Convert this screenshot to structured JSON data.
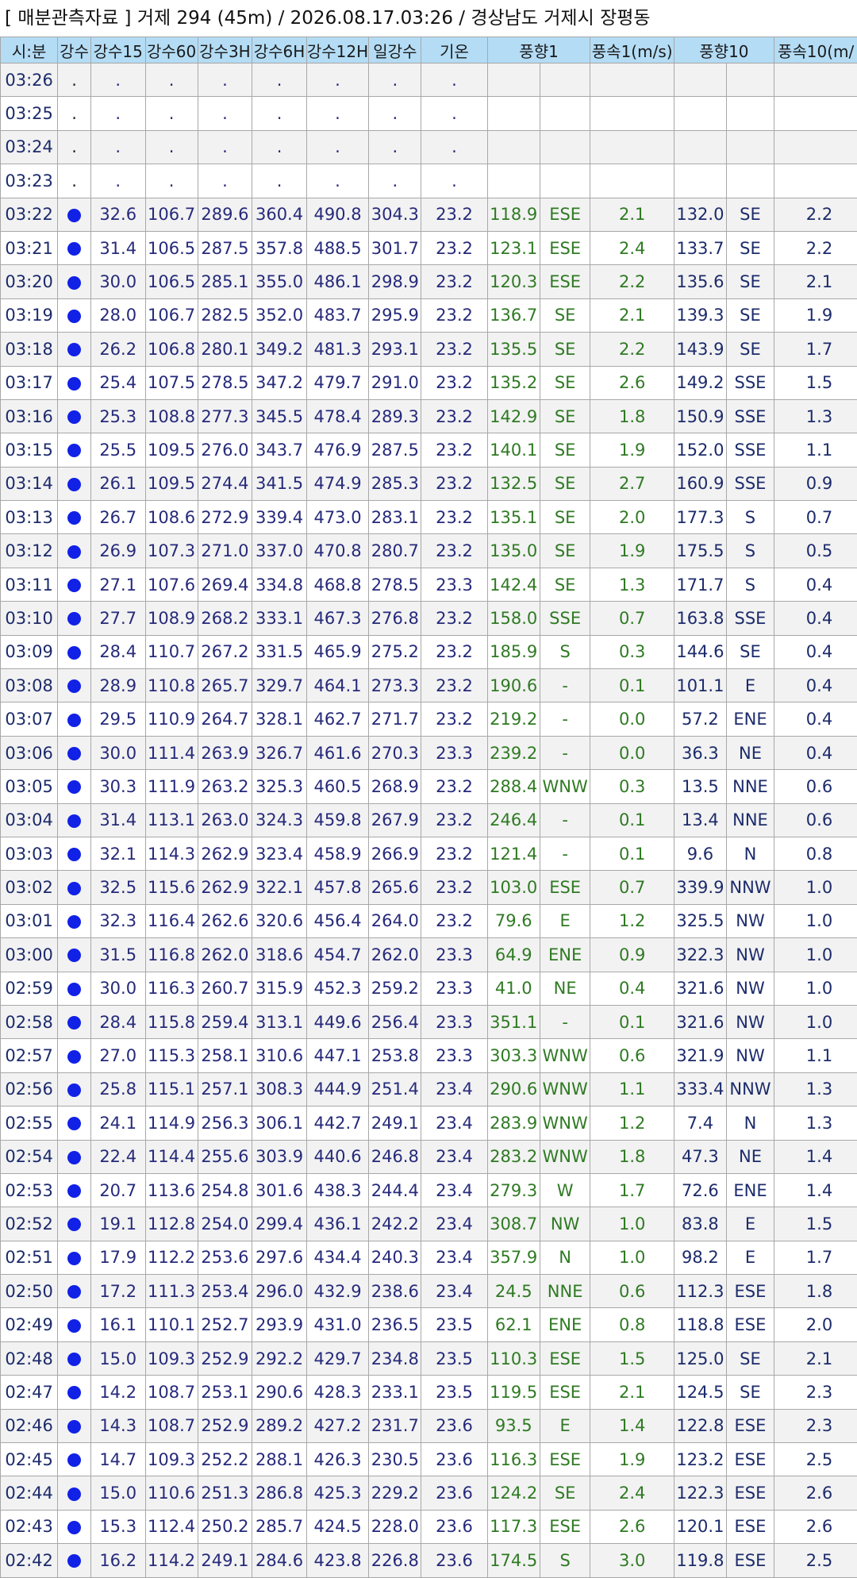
{
  "title": "[ 매분관측자료 ] 거제 294 (45m) / 2026.08.17.03:26 / 경상남도 거제시 장평동",
  "headers": {
    "time": "시:분",
    "rain": "강수",
    "r15": "강수15",
    "r60": "강수60",
    "r3h": "강수3H",
    "r6h": "강수6H",
    "r12h": "강수12H",
    "rday": "일강수",
    "temp": "기온",
    "wd1": "풍향1",
    "ws1": "풍속1(m/s)",
    "wd10": "풍향10",
    "ws10": "풍속10(m/"
  },
  "rain_indicator_color": "#1121e6",
  "empty_rows": [
    {
      "time": "03:26",
      "rain": ".",
      "r15": ".",
      "r60": ".",
      "r3h": ".",
      "r6h": ".",
      "r12h": ".",
      "rday": ".",
      "temp": "."
    },
    {
      "time": "03:25",
      "rain": ".",
      "r15": ".",
      "r60": ".",
      "r3h": ".",
      "r6h": ".",
      "r12h": ".",
      "rday": ".",
      "temp": "."
    },
    {
      "time": "03:24",
      "rain": ".",
      "r15": ".",
      "r60": ".",
      "r3h": ".",
      "r6h": ".",
      "r12h": ".",
      "rday": ".",
      "temp": "."
    },
    {
      "time": "03:23",
      "rain": ".",
      "r15": ".",
      "r60": ".",
      "r3h": ".",
      "r6h": ".",
      "r12h": ".",
      "rday": ".",
      "temp": "."
    }
  ],
  "rows": [
    {
      "time": "03:22",
      "r15": "32.6",
      "r60": "106.7",
      "r3h": "289.6",
      "r6h": "360.4",
      "r12h": "490.8",
      "rday": "304.3",
      "temp": "23.2",
      "wd1": "118.9",
      "wd1_dir": "ESE",
      "ws1": "2.1",
      "wd10": "132.0",
      "wd10_dir": "SE",
      "ws10": "2.2"
    },
    {
      "time": "03:21",
      "r15": "31.4",
      "r60": "106.5",
      "r3h": "287.5",
      "r6h": "357.8",
      "r12h": "488.5",
      "rday": "301.7",
      "temp": "23.2",
      "wd1": "123.1",
      "wd1_dir": "ESE",
      "ws1": "2.4",
      "wd10": "133.7",
      "wd10_dir": "SE",
      "ws10": "2.2"
    },
    {
      "time": "03:20",
      "r15": "30.0",
      "r60": "106.5",
      "r3h": "285.1",
      "r6h": "355.0",
      "r12h": "486.1",
      "rday": "298.9",
      "temp": "23.2",
      "wd1": "120.3",
      "wd1_dir": "ESE",
      "ws1": "2.2",
      "wd10": "135.6",
      "wd10_dir": "SE",
      "ws10": "2.1"
    },
    {
      "time": "03:19",
      "r15": "28.0",
      "r60": "106.7",
      "r3h": "282.5",
      "r6h": "352.0",
      "r12h": "483.7",
      "rday": "295.9",
      "temp": "23.2",
      "wd1": "136.7",
      "wd1_dir": "SE",
      "ws1": "2.1",
      "wd10": "139.3",
      "wd10_dir": "SE",
      "ws10": "1.9"
    },
    {
      "time": "03:18",
      "r15": "26.2",
      "r60": "106.8",
      "r3h": "280.1",
      "r6h": "349.2",
      "r12h": "481.3",
      "rday": "293.1",
      "temp": "23.2",
      "wd1": "135.5",
      "wd1_dir": "SE",
      "ws1": "2.2",
      "wd10": "143.9",
      "wd10_dir": "SE",
      "ws10": "1.7"
    },
    {
      "time": "03:17",
      "r15": "25.4",
      "r60": "107.5",
      "r3h": "278.5",
      "r6h": "347.2",
      "r12h": "479.7",
      "rday": "291.0",
      "temp": "23.2",
      "wd1": "135.2",
      "wd1_dir": "SE",
      "ws1": "2.6",
      "wd10": "149.2",
      "wd10_dir": "SSE",
      "ws10": "1.5"
    },
    {
      "time": "03:16",
      "r15": "25.3",
      "r60": "108.8",
      "r3h": "277.3",
      "r6h": "345.5",
      "r12h": "478.4",
      "rday": "289.3",
      "temp": "23.2",
      "wd1": "142.9",
      "wd1_dir": "SE",
      "ws1": "1.8",
      "wd10": "150.9",
      "wd10_dir": "SSE",
      "ws10": "1.3"
    },
    {
      "time": "03:15",
      "r15": "25.5",
      "r60": "109.5",
      "r3h": "276.0",
      "r6h": "343.7",
      "r12h": "476.9",
      "rday": "287.5",
      "temp": "23.2",
      "wd1": "140.1",
      "wd1_dir": "SE",
      "ws1": "1.9",
      "wd10": "152.0",
      "wd10_dir": "SSE",
      "ws10": "1.1"
    },
    {
      "time": "03:14",
      "r15": "26.1",
      "r60": "109.5",
      "r3h": "274.4",
      "r6h": "341.5",
      "r12h": "474.9",
      "rday": "285.3",
      "temp": "23.2",
      "wd1": "132.5",
      "wd1_dir": "SE",
      "ws1": "2.7",
      "wd10": "160.9",
      "wd10_dir": "SSE",
      "ws10": "0.9"
    },
    {
      "time": "03:13",
      "r15": "26.7",
      "r60": "108.6",
      "r3h": "272.9",
      "r6h": "339.4",
      "r12h": "473.0",
      "rday": "283.1",
      "temp": "23.2",
      "wd1": "135.1",
      "wd1_dir": "SE",
      "ws1": "2.0",
      "wd10": "177.3",
      "wd10_dir": "S",
      "ws10": "0.7"
    },
    {
      "time": "03:12",
      "r15": "26.9",
      "r60": "107.3",
      "r3h": "271.0",
      "r6h": "337.0",
      "r12h": "470.8",
      "rday": "280.7",
      "temp": "23.2",
      "wd1": "135.0",
      "wd1_dir": "SE",
      "ws1": "1.9",
      "wd10": "175.5",
      "wd10_dir": "S",
      "ws10": "0.5"
    },
    {
      "time": "03:11",
      "r15": "27.1",
      "r60": "107.6",
      "r3h": "269.4",
      "r6h": "334.8",
      "r12h": "468.8",
      "rday": "278.5",
      "temp": "23.3",
      "wd1": "142.4",
      "wd1_dir": "SE",
      "ws1": "1.3",
      "wd10": "171.7",
      "wd10_dir": "S",
      "ws10": "0.4"
    },
    {
      "time": "03:10",
      "r15": "27.7",
      "r60": "108.9",
      "r3h": "268.2",
      "r6h": "333.1",
      "r12h": "467.3",
      "rday": "276.8",
      "temp": "23.2",
      "wd1": "158.0",
      "wd1_dir": "SSE",
      "ws1": "0.7",
      "wd10": "163.8",
      "wd10_dir": "SSE",
      "ws10": "0.4"
    },
    {
      "time": "03:09",
      "r15": "28.4",
      "r60": "110.7",
      "r3h": "267.2",
      "r6h": "331.5",
      "r12h": "465.9",
      "rday": "275.2",
      "temp": "23.2",
      "wd1": "185.9",
      "wd1_dir": "S",
      "ws1": "0.3",
      "wd10": "144.6",
      "wd10_dir": "SE",
      "ws10": "0.4"
    },
    {
      "time": "03:08",
      "r15": "28.9",
      "r60": "110.8",
      "r3h": "265.7",
      "r6h": "329.7",
      "r12h": "464.1",
      "rday": "273.3",
      "temp": "23.2",
      "wd1": "190.6",
      "wd1_dir": "-",
      "ws1": "0.1",
      "wd10": "101.1",
      "wd10_dir": "E",
      "ws10": "0.4"
    },
    {
      "time": "03:07",
      "r15": "29.5",
      "r60": "110.9",
      "r3h": "264.7",
      "r6h": "328.1",
      "r12h": "462.7",
      "rday": "271.7",
      "temp": "23.2",
      "wd1": "219.2",
      "wd1_dir": "-",
      "ws1": "0.0",
      "wd10": "57.2",
      "wd10_dir": "ENE",
      "ws10": "0.4"
    },
    {
      "time": "03:06",
      "r15": "30.0",
      "r60": "111.4",
      "r3h": "263.9",
      "r6h": "326.7",
      "r12h": "461.6",
      "rday": "270.3",
      "temp": "23.3",
      "wd1": "239.2",
      "wd1_dir": "-",
      "ws1": "0.0",
      "wd10": "36.3",
      "wd10_dir": "NE",
      "ws10": "0.4"
    },
    {
      "time": "03:05",
      "r15": "30.3",
      "r60": "111.9",
      "r3h": "263.2",
      "r6h": "325.3",
      "r12h": "460.5",
      "rday": "268.9",
      "temp": "23.2",
      "wd1": "288.4",
      "wd1_dir": "WNW",
      "ws1": "0.3",
      "wd10": "13.5",
      "wd10_dir": "NNE",
      "ws10": "0.6"
    },
    {
      "time": "03:04",
      "r15": "31.4",
      "r60": "113.1",
      "r3h": "263.0",
      "r6h": "324.3",
      "r12h": "459.8",
      "rday": "267.9",
      "temp": "23.2",
      "wd1": "246.4",
      "wd1_dir": "-",
      "ws1": "0.1",
      "wd10": "13.4",
      "wd10_dir": "NNE",
      "ws10": "0.6"
    },
    {
      "time": "03:03",
      "r15": "32.1",
      "r60": "114.3",
      "r3h": "262.9",
      "r6h": "323.4",
      "r12h": "458.9",
      "rday": "266.9",
      "temp": "23.2",
      "wd1": "121.4",
      "wd1_dir": "-",
      "ws1": "0.1",
      "wd10": "9.6",
      "wd10_dir": "N",
      "ws10": "0.8"
    },
    {
      "time": "03:02",
      "r15": "32.5",
      "r60": "115.6",
      "r3h": "262.9",
      "r6h": "322.1",
      "r12h": "457.8",
      "rday": "265.6",
      "temp": "23.2",
      "wd1": "103.0",
      "wd1_dir": "ESE",
      "ws1": "0.7",
      "wd10": "339.9",
      "wd10_dir": "NNW",
      "ws10": "1.0"
    },
    {
      "time": "03:01",
      "r15": "32.3",
      "r60": "116.4",
      "r3h": "262.6",
      "r6h": "320.6",
      "r12h": "456.4",
      "rday": "264.0",
      "temp": "23.2",
      "wd1": "79.6",
      "wd1_dir": "E",
      "ws1": "1.2",
      "wd10": "325.5",
      "wd10_dir": "NW",
      "ws10": "1.0"
    },
    {
      "time": "03:00",
      "r15": "31.5",
      "r60": "116.8",
      "r3h": "262.0",
      "r6h": "318.6",
      "r12h": "454.7",
      "rday": "262.0",
      "temp": "23.3",
      "wd1": "64.9",
      "wd1_dir": "ENE",
      "ws1": "0.9",
      "wd10": "322.3",
      "wd10_dir": "NW",
      "ws10": "1.0"
    },
    {
      "time": "02:59",
      "r15": "30.0",
      "r60": "116.3",
      "r3h": "260.7",
      "r6h": "315.9",
      "r12h": "452.3",
      "rday": "259.2",
      "temp": "23.3",
      "wd1": "41.0",
      "wd1_dir": "NE",
      "ws1": "0.4",
      "wd10": "321.6",
      "wd10_dir": "NW",
      "ws10": "1.0"
    },
    {
      "time": "02:58",
      "r15": "28.4",
      "r60": "115.8",
      "r3h": "259.4",
      "r6h": "313.1",
      "r12h": "449.6",
      "rday": "256.4",
      "temp": "23.3",
      "wd1": "351.1",
      "wd1_dir": "-",
      "ws1": "0.1",
      "wd10": "321.6",
      "wd10_dir": "NW",
      "ws10": "1.0"
    },
    {
      "time": "02:57",
      "r15": "27.0",
      "r60": "115.3",
      "r3h": "258.1",
      "r6h": "310.6",
      "r12h": "447.1",
      "rday": "253.8",
      "temp": "23.3",
      "wd1": "303.3",
      "wd1_dir": "WNW",
      "ws1": "0.6",
      "wd10": "321.9",
      "wd10_dir": "NW",
      "ws10": "1.1"
    },
    {
      "time": "02:56",
      "r15": "25.8",
      "r60": "115.1",
      "r3h": "257.1",
      "r6h": "308.3",
      "r12h": "444.9",
      "rday": "251.4",
      "temp": "23.4",
      "wd1": "290.6",
      "wd1_dir": "WNW",
      "ws1": "1.1",
      "wd10": "333.4",
      "wd10_dir": "NNW",
      "ws10": "1.3"
    },
    {
      "time": "02:55",
      "r15": "24.1",
      "r60": "114.9",
      "r3h": "256.3",
      "r6h": "306.1",
      "r12h": "442.7",
      "rday": "249.1",
      "temp": "23.4",
      "wd1": "283.9",
      "wd1_dir": "WNW",
      "ws1": "1.2",
      "wd10": "7.4",
      "wd10_dir": "N",
      "ws10": "1.3"
    },
    {
      "time": "02:54",
      "r15": "22.4",
      "r60": "114.4",
      "r3h": "255.6",
      "r6h": "303.9",
      "r12h": "440.6",
      "rday": "246.8",
      "temp": "23.4",
      "wd1": "283.2",
      "wd1_dir": "WNW",
      "ws1": "1.8",
      "wd10": "47.3",
      "wd10_dir": "NE",
      "ws10": "1.4"
    },
    {
      "time": "02:53",
      "r15": "20.7",
      "r60": "113.6",
      "r3h": "254.8",
      "r6h": "301.6",
      "r12h": "438.3",
      "rday": "244.4",
      "temp": "23.4",
      "wd1": "279.3",
      "wd1_dir": "W",
      "ws1": "1.7",
      "wd10": "72.6",
      "wd10_dir": "ENE",
      "ws10": "1.4"
    },
    {
      "time": "02:52",
      "r15": "19.1",
      "r60": "112.8",
      "r3h": "254.0",
      "r6h": "299.4",
      "r12h": "436.1",
      "rday": "242.2",
      "temp": "23.4",
      "wd1": "308.7",
      "wd1_dir": "NW",
      "ws1": "1.0",
      "wd10": "83.8",
      "wd10_dir": "E",
      "ws10": "1.5"
    },
    {
      "time": "02:51",
      "r15": "17.9",
      "r60": "112.2",
      "r3h": "253.6",
      "r6h": "297.6",
      "r12h": "434.4",
      "rday": "240.3",
      "temp": "23.4",
      "wd1": "357.9",
      "wd1_dir": "N",
      "ws1": "1.0",
      "wd10": "98.2",
      "wd10_dir": "E",
      "ws10": "1.7"
    },
    {
      "time": "02:50",
      "r15": "17.2",
      "r60": "111.3",
      "r3h": "253.4",
      "r6h": "296.0",
      "r12h": "432.9",
      "rday": "238.6",
      "temp": "23.4",
      "wd1": "24.5",
      "wd1_dir": "NNE",
      "ws1": "0.6",
      "wd10": "112.3",
      "wd10_dir": "ESE",
      "ws10": "1.8"
    },
    {
      "time": "02:49",
      "r15": "16.1",
      "r60": "110.1",
      "r3h": "252.7",
      "r6h": "293.9",
      "r12h": "431.0",
      "rday": "236.5",
      "temp": "23.5",
      "wd1": "62.1",
      "wd1_dir": "ENE",
      "ws1": "0.8",
      "wd10": "118.8",
      "wd10_dir": "ESE",
      "ws10": "2.0"
    },
    {
      "time": "02:48",
      "r15": "15.0",
      "r60": "109.3",
      "r3h": "252.9",
      "r6h": "292.2",
      "r12h": "429.7",
      "rday": "234.8",
      "temp": "23.5",
      "wd1": "110.3",
      "wd1_dir": "ESE",
      "ws1": "1.5",
      "wd10": "125.0",
      "wd10_dir": "SE",
      "ws10": "2.1"
    },
    {
      "time": "02:47",
      "r15": "14.2",
      "r60": "108.7",
      "r3h": "253.1",
      "r6h": "290.6",
      "r12h": "428.3",
      "rday": "233.1",
      "temp": "23.5",
      "wd1": "119.5",
      "wd1_dir": "ESE",
      "ws1": "2.1",
      "wd10": "124.5",
      "wd10_dir": "SE",
      "ws10": "2.3"
    },
    {
      "time": "02:46",
      "r15": "14.3",
      "r60": "108.7",
      "r3h": "252.9",
      "r6h": "289.2",
      "r12h": "427.2",
      "rday": "231.7",
      "temp": "23.6",
      "wd1": "93.5",
      "wd1_dir": "E",
      "ws1": "1.4",
      "wd10": "122.8",
      "wd10_dir": "ESE",
      "ws10": "2.3"
    },
    {
      "time": "02:45",
      "r15": "14.7",
      "r60": "109.3",
      "r3h": "252.2",
      "r6h": "288.1",
      "r12h": "426.3",
      "rday": "230.5",
      "temp": "23.6",
      "wd1": "116.3",
      "wd1_dir": "ESE",
      "ws1": "1.9",
      "wd10": "123.2",
      "wd10_dir": "ESE",
      "ws10": "2.5"
    },
    {
      "time": "02:44",
      "r15": "15.0",
      "r60": "110.6",
      "r3h": "251.3",
      "r6h": "286.8",
      "r12h": "425.3",
      "rday": "229.2",
      "temp": "23.6",
      "wd1": "124.2",
      "wd1_dir": "SE",
      "ws1": "2.4",
      "wd10": "122.3",
      "wd10_dir": "ESE",
      "ws10": "2.6"
    },
    {
      "time": "02:43",
      "r15": "15.3",
      "r60": "112.4",
      "r3h": "250.2",
      "r6h": "285.7",
      "r12h": "424.5",
      "rday": "228.0",
      "temp": "23.6",
      "wd1": "117.3",
      "wd1_dir": "ESE",
      "ws1": "2.6",
      "wd10": "120.1",
      "wd10_dir": "ESE",
      "ws10": "2.6"
    },
    {
      "time": "02:42",
      "r15": "16.2",
      "r60": "114.2",
      "r3h": "249.1",
      "r6h": "284.6",
      "r12h": "423.8",
      "rday": "226.8",
      "temp": "23.6",
      "wd1": "174.5",
      "wd1_dir": "S",
      "ws1": "3.0",
      "wd10": "119.8",
      "wd10_dir": "ESE",
      "ws10": "2.5"
    }
  ]
}
